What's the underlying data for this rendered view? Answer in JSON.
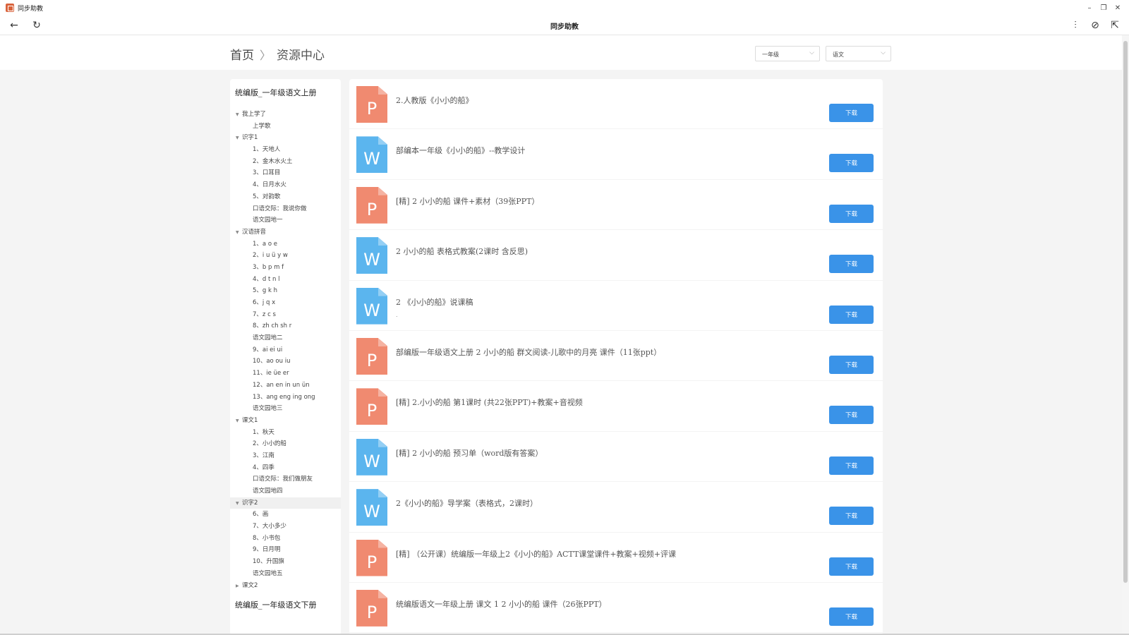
{
  "window": {
    "app_title": "同步助教",
    "controls": [
      "–",
      "❐",
      "✕"
    ]
  },
  "toolbar": {
    "title": "同步助教",
    "back_icon": "←",
    "refresh_icon": "↻",
    "settings_icon": "⫶",
    "compass_icon": "⊘",
    "export_icon": "⇱"
  },
  "breadcrumb": {
    "home": "首页",
    "separator": "〉",
    "current": "资源中心"
  },
  "filters": {
    "grade": "一年级",
    "subject": "语文",
    "chevron": "⌵"
  },
  "sidebar": {
    "book1_title": "统编版_一年级语文上册",
    "book2_title": "统编版_一年级语文下册",
    "tree": [
      {
        "label": "我上学了",
        "type": "group",
        "expanded": true
      },
      {
        "label": "上学歌",
        "type": "child"
      },
      {
        "label": "识字1",
        "type": "group",
        "expanded": true
      },
      {
        "label": "1、天地人",
        "type": "child"
      },
      {
        "label": "2、金木水火土",
        "type": "child"
      },
      {
        "label": "3、口耳目",
        "type": "child"
      },
      {
        "label": "4、日月水火",
        "type": "child"
      },
      {
        "label": "5、对韵歌",
        "type": "child"
      },
      {
        "label": "口语交际：我说你做",
        "type": "child"
      },
      {
        "label": "语文园地一",
        "type": "child"
      },
      {
        "label": "汉语拼音",
        "type": "group",
        "expanded": true
      },
      {
        "label": "1、a o e",
        "type": "child"
      },
      {
        "label": "2、i u ü y w",
        "type": "child"
      },
      {
        "label": "3、b p m f",
        "type": "child"
      },
      {
        "label": "4、d t n l",
        "type": "child"
      },
      {
        "label": "5、g k h",
        "type": "child"
      },
      {
        "label": "6、j q x",
        "type": "child"
      },
      {
        "label": "7、z c s",
        "type": "child"
      },
      {
        "label": "8、zh ch sh r",
        "type": "child"
      },
      {
        "label": "语文园地二",
        "type": "child"
      },
      {
        "label": "9、ai ei ui",
        "type": "child"
      },
      {
        "label": "10、ao ou iu",
        "type": "child"
      },
      {
        "label": "11、ie üe er",
        "type": "child"
      },
      {
        "label": "12、an en in un ün",
        "type": "child"
      },
      {
        "label": "13、ang eng ing ong",
        "type": "child"
      },
      {
        "label": "语文园地三",
        "type": "child"
      },
      {
        "label": "课文1",
        "type": "group",
        "expanded": true
      },
      {
        "label": "1、秋天",
        "type": "child"
      },
      {
        "label": "2、小小的船",
        "type": "child"
      },
      {
        "label": "3、江南",
        "type": "child"
      },
      {
        "label": "4、四季",
        "type": "child"
      },
      {
        "label": "口语交际：我们做朋友",
        "type": "child"
      },
      {
        "label": "语文园地四",
        "type": "child"
      },
      {
        "label": "识字2",
        "type": "group",
        "expanded": true,
        "active": true
      },
      {
        "label": "6、画",
        "type": "child"
      },
      {
        "label": "7、大小多少",
        "type": "child"
      },
      {
        "label": "8、小书包",
        "type": "child"
      },
      {
        "label": "9、日月明",
        "type": "child"
      },
      {
        "label": "10、升国旗",
        "type": "child"
      },
      {
        "label": "语文园地五",
        "type": "child"
      },
      {
        "label": "课文2",
        "type": "group",
        "expanded": false
      }
    ]
  },
  "resources": {
    "download_label": "下载",
    "colors": {
      "ppt": "#f08a70",
      "word": "#5bb5ee",
      "button": "#3a93e8"
    },
    "items": [
      {
        "kind": "ppt",
        "letter": "P",
        "title": "2.人教版《小小的船》",
        "sub": ""
      },
      {
        "kind": "word",
        "letter": "W",
        "title": "部编本一年级《小小的船》--教学设计",
        "sub": ""
      },
      {
        "kind": "ppt",
        "letter": "P",
        "title": "[精] 2 小小的船 课件+素材（39张PPT）",
        "sub": ""
      },
      {
        "kind": "word",
        "letter": "W",
        "title": "2 小小的船 表格式教案(2课时 含反思)",
        "sub": ""
      },
      {
        "kind": "word",
        "letter": "W",
        "title": "2 《小小的船》说课稿",
        "sub": "."
      },
      {
        "kind": "ppt",
        "letter": "P",
        "title": "部编版一年级语文上册 2 小小的船 群文阅读-儿歌中的月亮 课件（11张ppt）",
        "sub": ""
      },
      {
        "kind": "ppt",
        "letter": "P",
        "title": "[精] 2.小小的船 第1课时 (共22张PPT)+教案+音视频",
        "sub": ""
      },
      {
        "kind": "word",
        "letter": "W",
        "title": "[精] 2 小小的船 预习单（word版有答案）",
        "sub": ""
      },
      {
        "kind": "word",
        "letter": "W",
        "title": "2《小小的船》导学案（表格式，2课时）",
        "sub": ""
      },
      {
        "kind": "ppt",
        "letter": "P",
        "title": "[精] （公开课）统编版一年级上2《小小的船》ACTT课堂课件+教案+视频+评课",
        "sub": ""
      },
      {
        "kind": "ppt",
        "letter": "P",
        "title": "统编版语文一年级上册 课文 1 2 小小的船 课件（26张PPT）",
        "sub": ""
      }
    ]
  }
}
